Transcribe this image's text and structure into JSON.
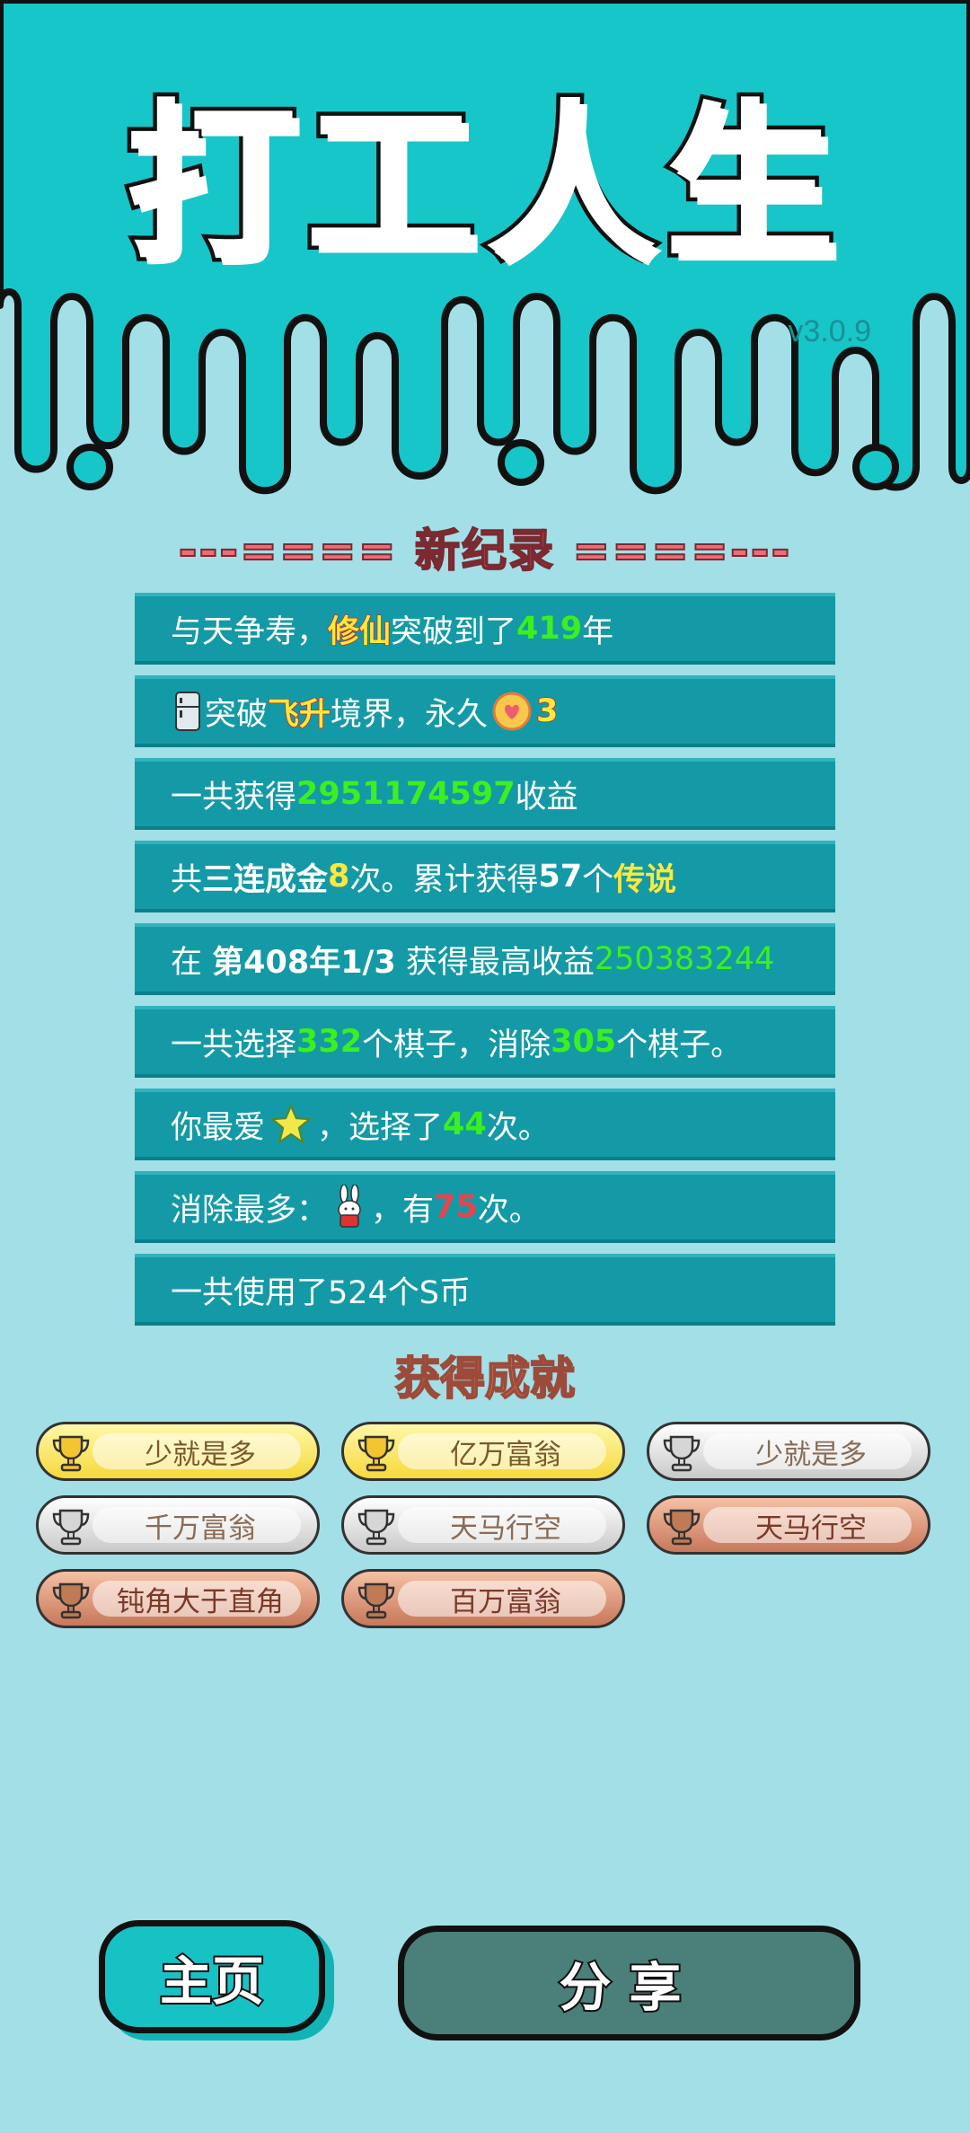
{
  "app": {
    "title": "打工人生",
    "version": "v3.0.9"
  },
  "record": {
    "title": "---==== 新纪录 ====---"
  },
  "stats": {
    "row1": {
      "a": "与天争寿，",
      "b": "修仙",
      "c": "突破到了",
      "d": "419",
      "e": "年"
    },
    "row2": {
      "a": "突破",
      "b": "飞升",
      "c": "境界，永久",
      "d": "3"
    },
    "row3": {
      "a": "一共获得",
      "b": "2951174597",
      "c": "收益"
    },
    "row4": {
      "a": "共",
      "b": "三连成金",
      "c": "8",
      "d": "次。累计获得",
      "e": "57",
      "f": "个",
      "g": "传说"
    },
    "row5": {
      "a": "在 ",
      "b": "第408年1/3",
      "c": " 获得最高收益",
      "d": "250383244"
    },
    "row6": {
      "a": "一共选择",
      "b": "332",
      "c": "个棋子，消除",
      "d": "305",
      "e": "个棋子。"
    },
    "row7": {
      "a": "你最爱",
      "b": "，选择了",
      "c": "44",
      "d": "次。"
    },
    "row8": {
      "a": "消除最多：",
      "b": "，有",
      "c": "75",
      "d": "次。"
    },
    "row9": {
      "a": "一共使用了524个S币"
    }
  },
  "achievements": {
    "title": "获得成就",
    "items": [
      {
        "label": "少就是多",
        "tier": "gold"
      },
      {
        "label": "亿万富翁",
        "tier": "gold"
      },
      {
        "label": "少就是多",
        "tier": "silver"
      },
      {
        "label": "千万富翁",
        "tier": "silver"
      },
      {
        "label": "天马行空",
        "tier": "silver"
      },
      {
        "label": "天马行空",
        "tier": "bronze"
      },
      {
        "label": "钝角大于直角",
        "tier": "bronze"
      },
      {
        "label": "百万富翁",
        "tier": "bronze"
      }
    ]
  },
  "buttons": {
    "home": "主页",
    "share": "分享"
  },
  "colors": {
    "top_teal": "#17c6c8",
    "page_bg": "#a3dfe6",
    "row_bg": "#149aa6",
    "share_bg": "#4a7f7a"
  },
  "icons": {
    "row2_left": "fridge-icon",
    "row2_right": "coin-heart-icon",
    "row7": "star-icon",
    "row8": "rabbit-icon",
    "trophy": "trophy-icon"
  }
}
